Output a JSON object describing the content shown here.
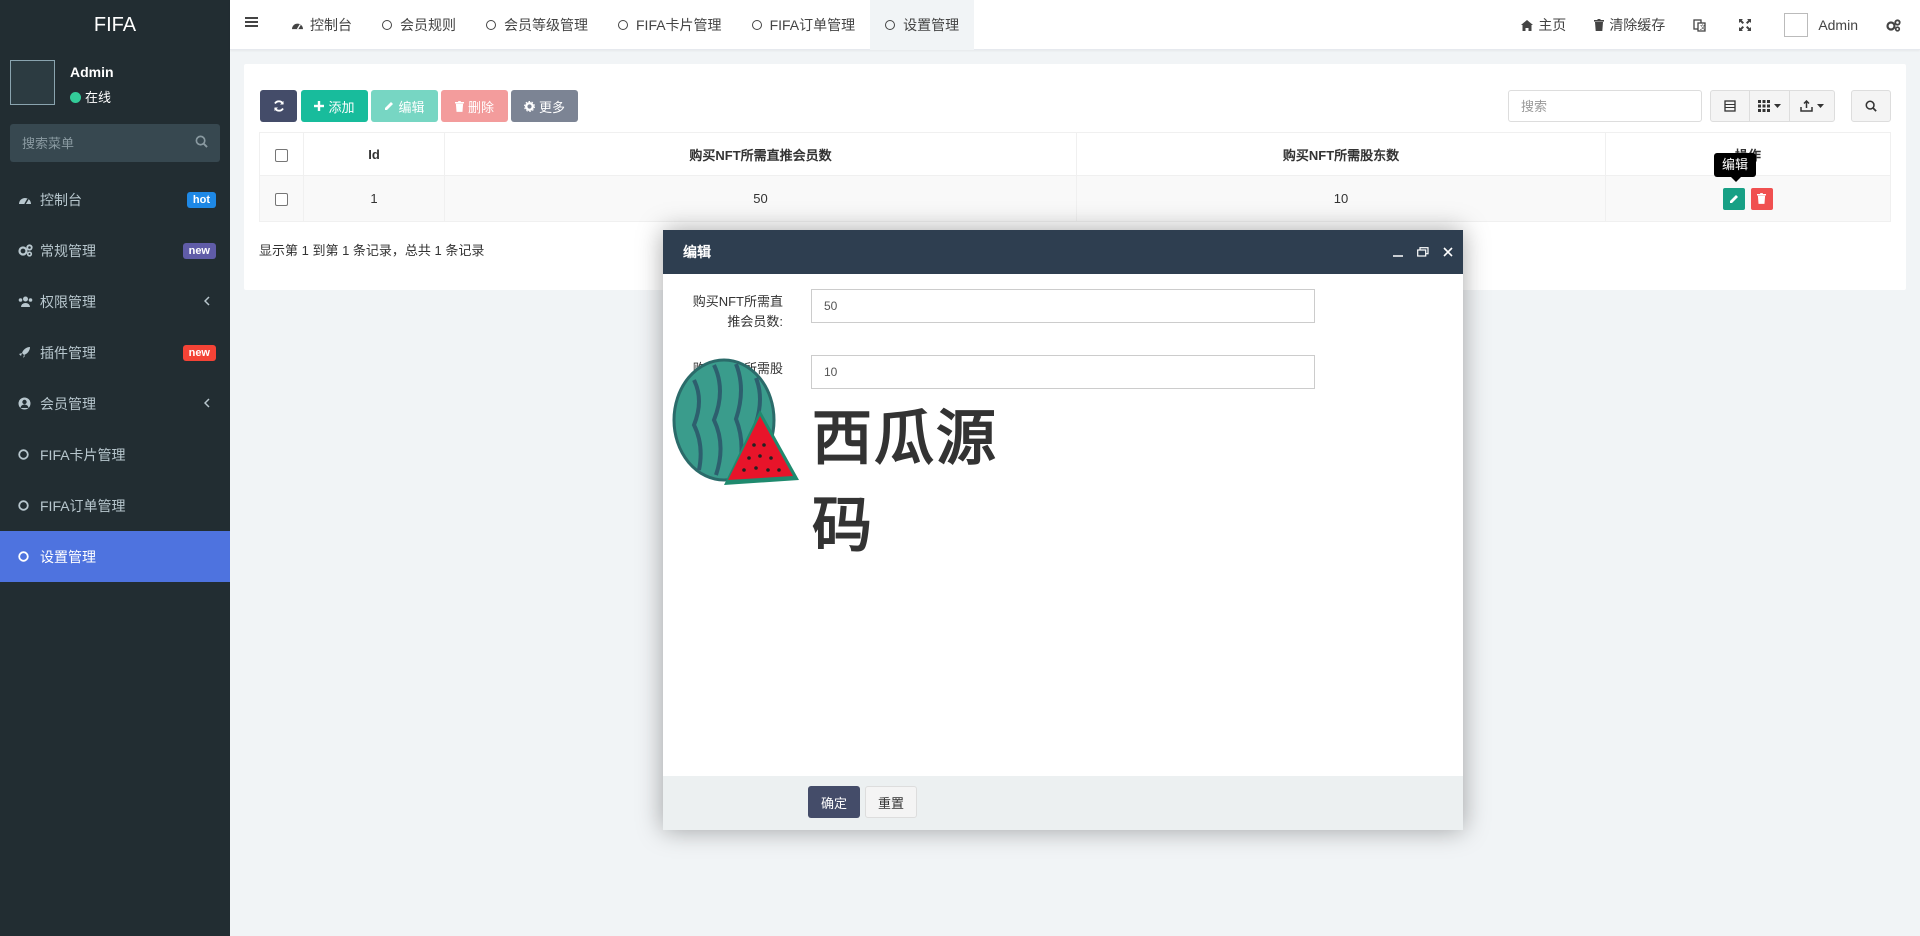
{
  "sidebar": {
    "logo": "FIFA",
    "user": {
      "name": "Admin",
      "status": "在线"
    },
    "search_placeholder": "搜索菜单",
    "items": [
      {
        "label": "控制台",
        "badge": "hot",
        "badge_color": "#1e88e5",
        "icon": "dashboard-icon"
      },
      {
        "label": "常规管理",
        "badge": "new",
        "badge_color": "#605ca8",
        "icon": "cogs-icon"
      },
      {
        "label": "权限管理",
        "icon": "group-icon"
      },
      {
        "label": "插件管理",
        "badge": "new",
        "badge_color": "#f44336",
        "icon": "rocket-icon"
      },
      {
        "label": "会员管理",
        "icon": "user-circle-icon"
      },
      {
        "label": "FIFA卡片管理",
        "icon": "circle-icon"
      },
      {
        "label": "FIFA订单管理",
        "icon": "circle-icon"
      },
      {
        "label": "设置管理",
        "icon": "circle-icon",
        "active": true
      }
    ]
  },
  "topbar": {
    "tabs": [
      {
        "label": "控制台",
        "icon": "dashboard-icon"
      },
      {
        "label": "会员规则",
        "icon": "circle-icon"
      },
      {
        "label": "会员等级管理",
        "icon": "circle-icon"
      },
      {
        "label": "FIFA卡片管理",
        "icon": "circle-icon"
      },
      {
        "label": "FIFA订单管理",
        "icon": "circle-icon"
      },
      {
        "label": "设置管理",
        "icon": "circle-icon",
        "active": true
      }
    ],
    "home": "主页",
    "clear_cache": "清除缓存",
    "user": "Admin"
  },
  "toolbar": {
    "add": "添加",
    "edit": "编辑",
    "delete": "删除",
    "more": "更多",
    "search_placeholder": "搜索"
  },
  "table": {
    "columns": [
      "Id",
      "购买NFT所需直推会员数",
      "购买NFT所需股东数",
      "操作"
    ],
    "rows": [
      {
        "id": "1",
        "direct_members": "50",
        "shareholders": "10"
      }
    ],
    "tooltip": "编辑",
    "page_info": "显示第 1 到第 1 条记录，总共 1 条记录"
  },
  "modal": {
    "title": "编辑",
    "field1_label_line1": "购买NFT所需直",
    "field1_label_line2": "推会员数:",
    "field1_value": "50",
    "field2_label": "购买NFT所需股",
    "field2_value": "10",
    "confirm": "确定",
    "reset": "重置"
  },
  "watermark": {
    "text": "西瓜源码"
  },
  "colors": {
    "sidebar_bg": "#222d32",
    "active_blue": "#4e73df",
    "refresh_btn": "#444c69",
    "add_btn": "#18bc9c",
    "edit_btn": "#77d6c3",
    "delete_btn": "#f39c9c",
    "more_btn": "#7c8494",
    "modal_header": "#2e3e50"
  }
}
